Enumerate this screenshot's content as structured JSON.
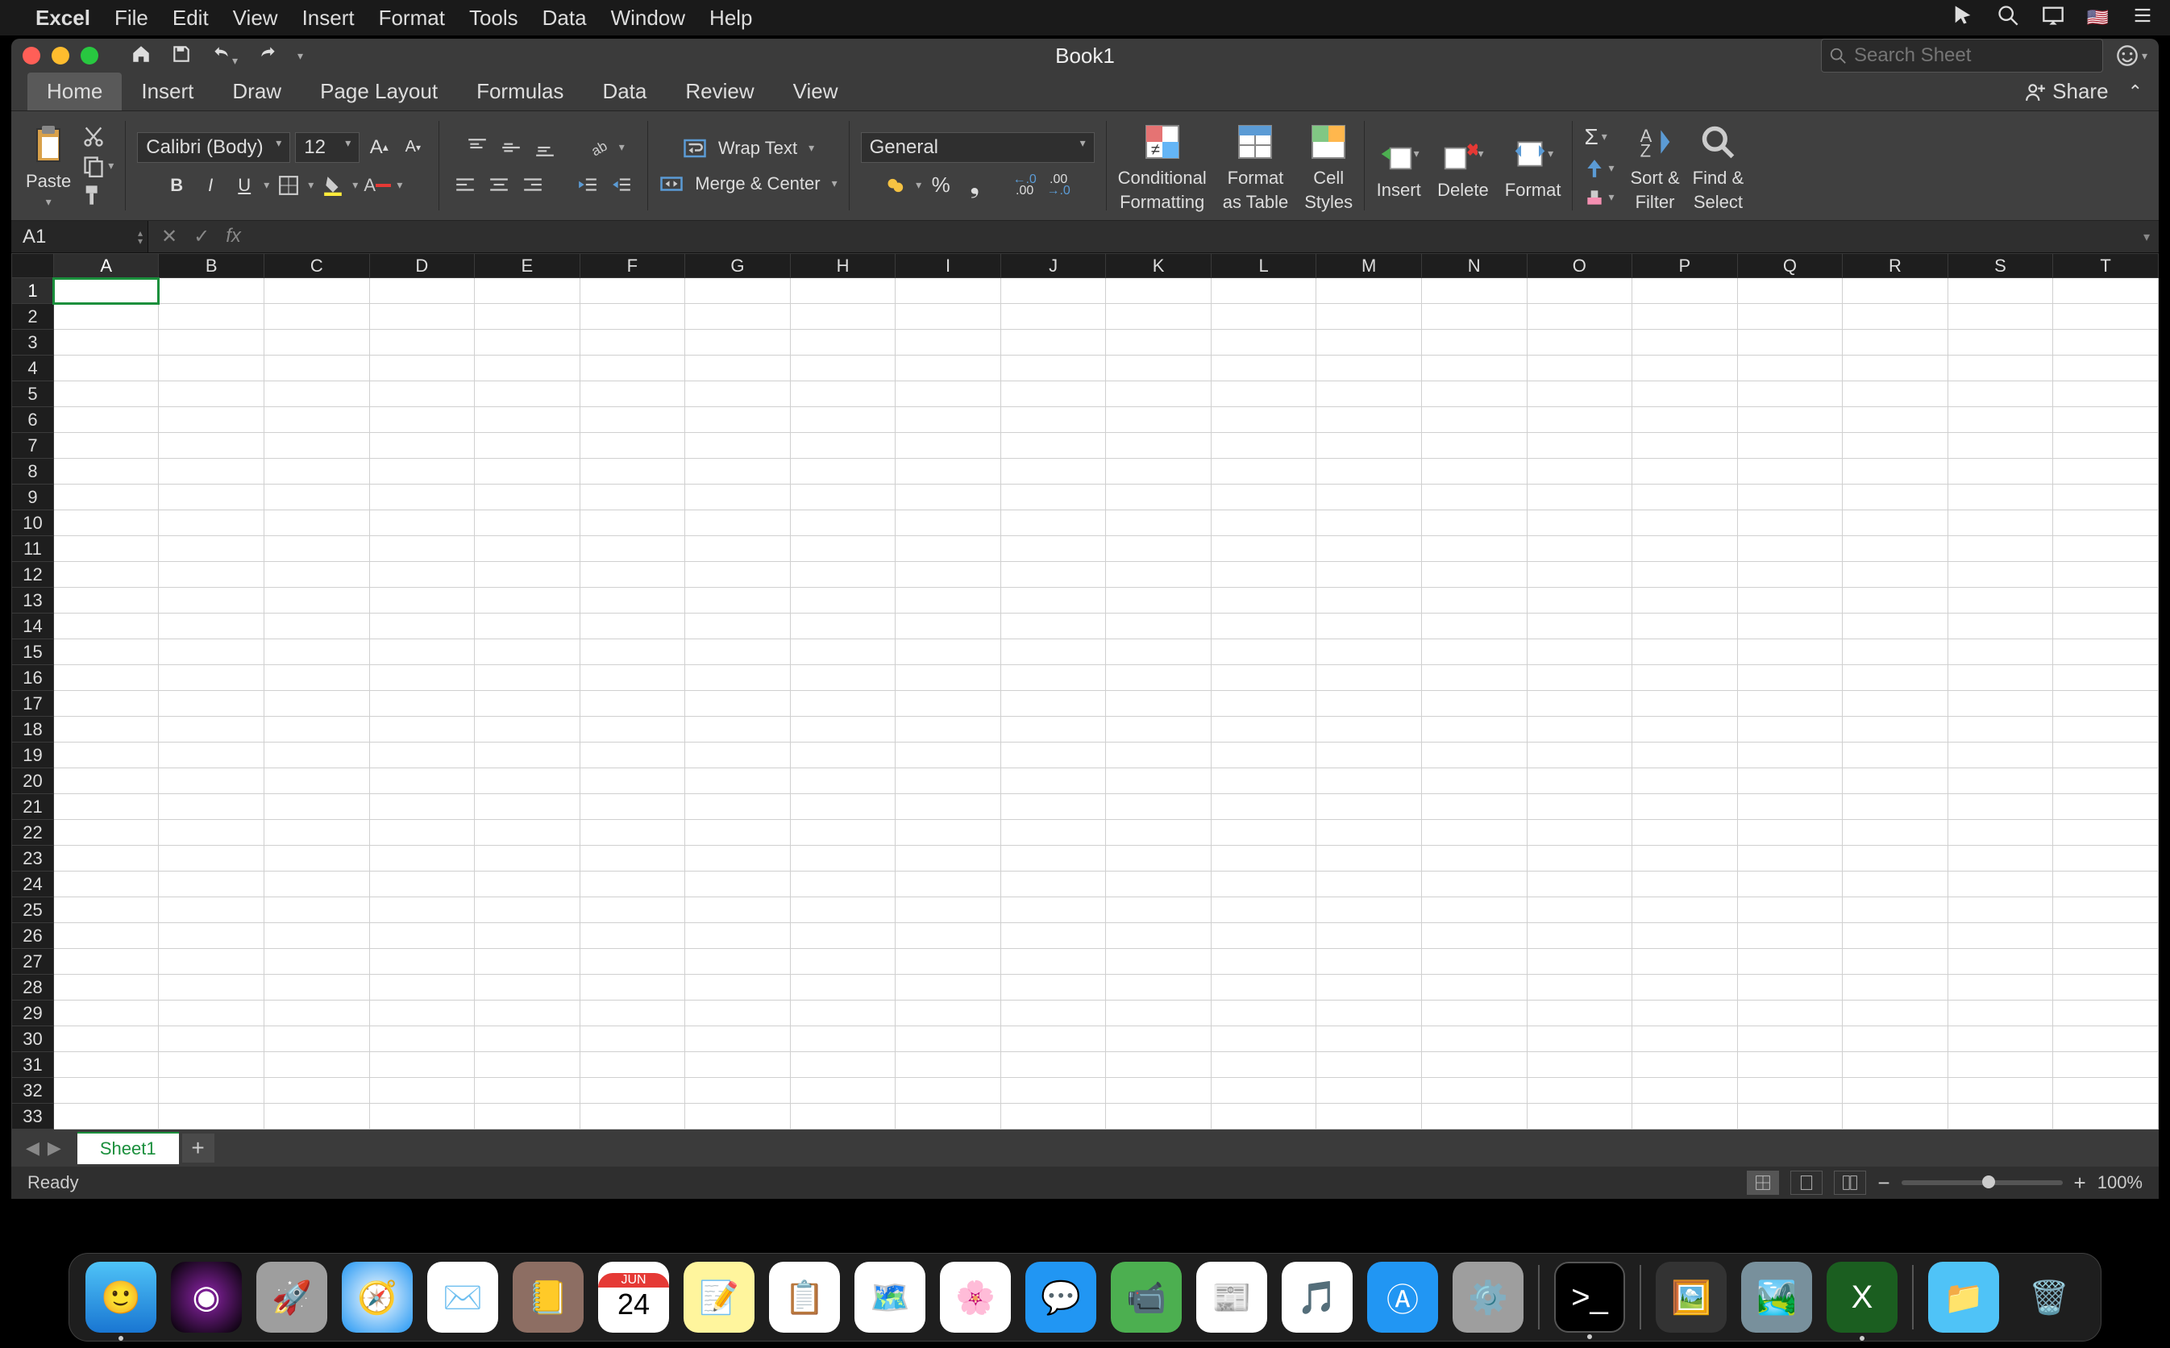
{
  "menubar": {
    "app": "Excel",
    "items": [
      "File",
      "Edit",
      "View",
      "Insert",
      "Format",
      "Tools",
      "Data",
      "Window",
      "Help"
    ]
  },
  "window": {
    "title": "Book1",
    "search_placeholder": "Search Sheet"
  },
  "ribbon_tabs": [
    "Home",
    "Insert",
    "Draw",
    "Page Layout",
    "Formulas",
    "Data",
    "Review",
    "View"
  ],
  "ribbon_active_tab": "Home",
  "share_label": "Share",
  "ribbon": {
    "paste": "Paste",
    "font_name": "Calibri (Body)",
    "font_size": "12",
    "wrap_text": "Wrap Text",
    "merge_center": "Merge & Center",
    "number_format": "General",
    "conditional_formatting_l1": "Conditional",
    "conditional_formatting_l2": "Formatting",
    "format_as_table_l1": "Format",
    "format_as_table_l2": "as Table",
    "cell_styles_l1": "Cell",
    "cell_styles_l2": "Styles",
    "insert": "Insert",
    "delete": "Delete",
    "format": "Format",
    "sort_filter_l1": "Sort &",
    "sort_filter_l2": "Filter",
    "find_select_l1": "Find &",
    "find_select_l2": "Select"
  },
  "namebox": "A1",
  "formula_value": "",
  "columns": [
    "A",
    "B",
    "C",
    "D",
    "E",
    "F",
    "G",
    "H",
    "I",
    "J",
    "K",
    "L",
    "M",
    "N",
    "O",
    "P",
    "Q",
    "R",
    "S",
    "T"
  ],
  "rows": [
    "1",
    "2",
    "3",
    "4",
    "5",
    "6",
    "7",
    "8",
    "9",
    "10",
    "11",
    "12",
    "13",
    "14",
    "15",
    "16",
    "17",
    "18",
    "19",
    "20",
    "21",
    "22",
    "23",
    "24",
    "25",
    "26",
    "27",
    "28",
    "29",
    "30",
    "31",
    "32",
    "33"
  ],
  "selected_cell": "A1",
  "sheet_tabs": [
    "Sheet1"
  ],
  "status": "Ready",
  "zoom": "100%",
  "dock": {
    "calendar_month": "JUN",
    "calendar_day": "24"
  }
}
